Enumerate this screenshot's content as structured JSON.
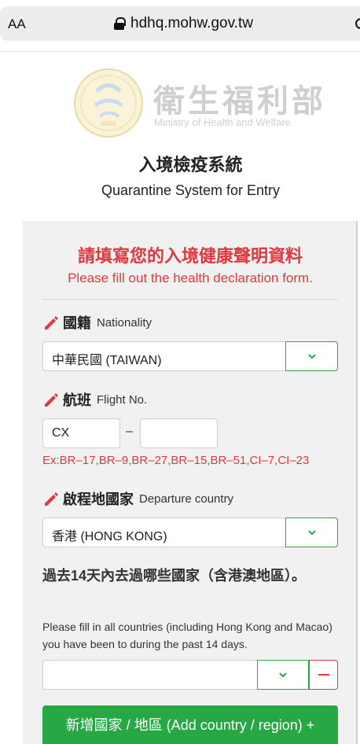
{
  "browser": {
    "text_size_label": "AA",
    "url": "hdhq.mohw.gov.tw"
  },
  "header": {
    "ministry_zh": "衛生福利部",
    "ministry_en": "Ministry of Health and Welfare",
    "system_zh": "入境檢疫系統",
    "system_en": "Quarantine System for Entry"
  },
  "form": {
    "title_zh": "請填寫您的入境健康聲明資料",
    "title_en": "Please fill out the health declaration form.",
    "nationality": {
      "label_zh": "國籍",
      "label_en": "Nationality",
      "value": "中華民國 (TAIWAN)"
    },
    "flight": {
      "label_zh": "航班",
      "label_en": "Flight No.",
      "prefix": "CX",
      "number": "",
      "separator": "–",
      "example": "Ex:BR–17,BR–9,BR–27,BR–15,BR–51,CI–7,CI–23"
    },
    "departure": {
      "label_zh": "啟程地國家",
      "label_en": "Departure country",
      "value": "香港 (HONG KONG)"
    },
    "visited": {
      "question_zh": "過去14天內去過哪些國家（含港澳地區）。",
      "question_en": "Please fill in all countries (including Hong Kong and Macao) you have been to during the past 14 days.",
      "value": ""
    },
    "add_button_label": "新增國家 / 地區 (Add country / region) +"
  },
  "colors": {
    "accent_red": "#e0383e",
    "accent_green": "#28a745"
  }
}
